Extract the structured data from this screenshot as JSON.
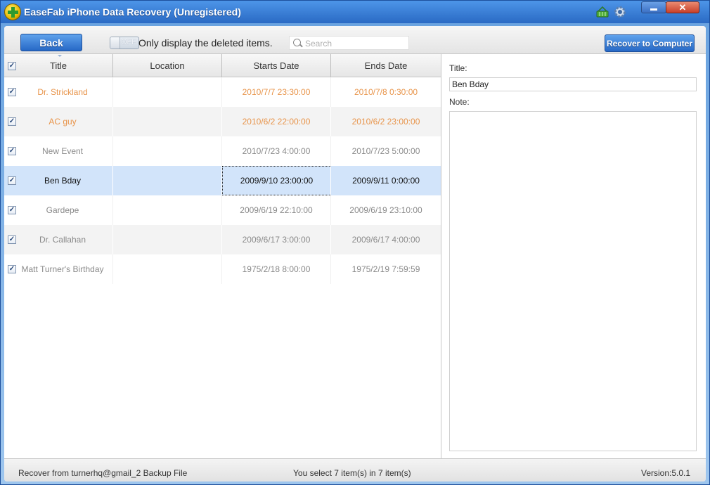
{
  "window": {
    "title": "EaseFab iPhone Data Recovery (Unregistered)"
  },
  "toolbar": {
    "back_label": "Back",
    "toggle_state": "OFF",
    "toggle_text": "Only display the deleted items.",
    "search_placeholder": "Search",
    "recover_label": "Recover to Computer"
  },
  "table": {
    "columns": [
      "Title",
      "Location",
      "Starts Date",
      "Ends Date"
    ],
    "rows": [
      {
        "title": "Dr. Strickland",
        "location": "",
        "starts": "2010/7/7 23:30:00",
        "ends": "2010/7/8 0:30:00",
        "checked": true,
        "color": "#e8944a"
      },
      {
        "title": "AC guy",
        "location": "",
        "starts": "2010/6/2 22:00:00",
        "ends": "2010/6/2 23:00:00",
        "checked": true,
        "color": "#e8944a"
      },
      {
        "title": "New Event",
        "location": "",
        "starts": "2010/7/23 4:00:00",
        "ends": "2010/7/23 5:00:00",
        "checked": true,
        "color": "#8a8a8a"
      },
      {
        "title": "Ben Bday",
        "location": "",
        "starts": "2009/9/10 23:00:00",
        "ends": "2009/9/11 0:00:00",
        "checked": true,
        "color": "#111111"
      },
      {
        "title": "Gardepe",
        "location": "",
        "starts": "2009/6/19 22:10:00",
        "ends": "2009/6/19 23:10:00",
        "checked": true,
        "color": "#8a8a8a"
      },
      {
        "title": "Dr. Callahan",
        "location": "",
        "starts": "2009/6/17 3:00:00",
        "ends": "2009/6/17 4:00:00",
        "checked": true,
        "color": "#8a8a8a"
      },
      {
        "title": "Matt Turner's Birthday",
        "location": "",
        "starts": "1975/2/18 8:00:00",
        "ends": "1975/2/19 7:59:59",
        "checked": true,
        "color": "#8a8a8a"
      }
    ]
  },
  "detail": {
    "title_label": "Title:",
    "title_value": "Ben Bday",
    "note_label": "Note:",
    "note_value": ""
  },
  "status": {
    "source": "Recover from turnerhq@gmail_2 Backup File",
    "selection": "You select 7 item(s) in 7 item(s)",
    "version": "Version:5.0.1"
  }
}
